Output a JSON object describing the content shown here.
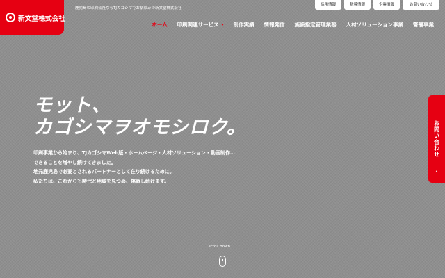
{
  "brand": {
    "logo_text": "新文堂株式会社",
    "tagline": "鹿児島の印刷会社ならTJカゴシマでお馴染みの新文堂株式会社"
  },
  "utility_nav": [
    {
      "label": "採用情報"
    },
    {
      "label": "新着情報"
    },
    {
      "label": "企業情報"
    },
    {
      "label": "お問い合わせ"
    }
  ],
  "main_nav": [
    {
      "label": "ホーム",
      "active": true
    },
    {
      "label": "印刷関連サービス",
      "has_dropdown": true
    },
    {
      "label": "制作実績"
    },
    {
      "label": "情報発信"
    },
    {
      "label": "施設指定管理業務"
    },
    {
      "label": "人材ソリューション事業"
    },
    {
      "label": "警備事業"
    }
  ],
  "hero": {
    "title_line1": "モット、",
    "title_line2": "カゴシマヲオモシロク。",
    "body": [
      "印刷事業から始まり、TJカゴシマWeb版・ホームページ・人材ソリューション・動画制作…",
      "できることを増やし続けてきました。",
      "地元鹿児島で必要とされるパートナーとして在り続けるために。",
      "私たちは、これからも時代と地域を見つめ、挑戦し続けます。"
    ]
  },
  "scroll": {
    "label": "scroll down",
    "icon": "mouse-icon"
  },
  "side_tab": {
    "label": "お問い合わせ",
    "chevron": "‹"
  },
  "colors": {
    "accent": "#e60012",
    "background": "#8f8f8f",
    "text": "#ffffff"
  }
}
